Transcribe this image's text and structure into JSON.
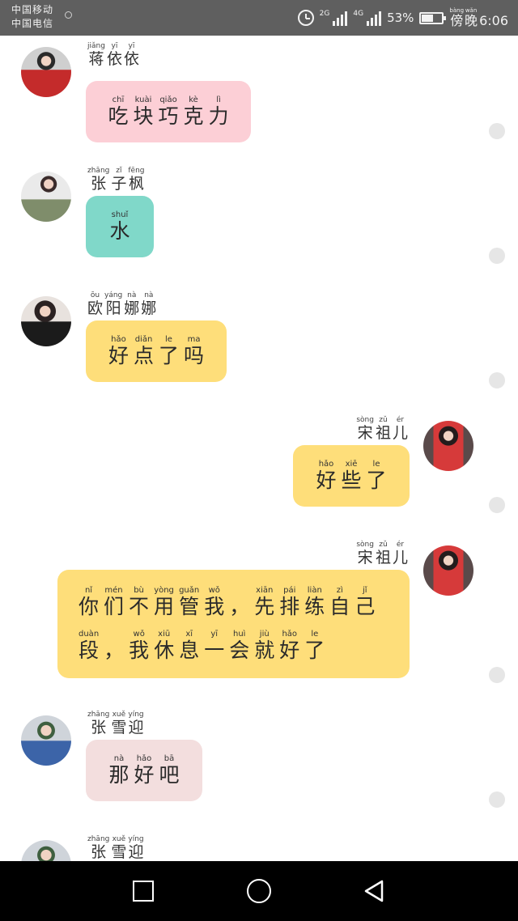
{
  "status_bar": {
    "carrier_1": "中国移动",
    "carrier_2": "中国电信",
    "net_1": "2G",
    "net_2": "4G",
    "battery_text": "53%",
    "battery_level": 0.53,
    "time_prefix": [
      {
        "py": "bàng",
        "hz": "傍"
      },
      {
        "py": "wǎn",
        "hz": "晚"
      }
    ],
    "time": "6:06",
    "alarm_icon": "alarm-clock-icon",
    "battery_icon": "battery-icon"
  },
  "messages": [
    {
      "side": "left",
      "sender": [
        {
          "py": "jiǎng",
          "hz": "蒋"
        },
        {
          "py": "yī",
          "hz": "依"
        },
        {
          "py": "yī",
          "hz": "依"
        }
      ],
      "bubble_color": "#fccfd6",
      "avatar": "avatar-girl-red-coat",
      "lines": [
        [
          {
            "py": "chī",
            "hz": "吃"
          },
          {
            "py": "kuài",
            "hz": "块"
          },
          {
            "py": "qiǎo",
            "hz": "巧"
          },
          {
            "py": "kè",
            "hz": "克"
          },
          {
            "py": "lì",
            "hz": "力"
          }
        ]
      ]
    },
    {
      "side": "left",
      "sender": [
        {
          "py": "zhāng",
          "hz": "张"
        },
        {
          "py": "zǐ",
          "hz": "子"
        },
        {
          "py": "fēng",
          "hz": "枫"
        }
      ],
      "bubble_color": "#80d8c9",
      "avatar": "avatar-girl-white-dress",
      "lines": [
        [
          {
            "py": "shuǐ",
            "hz": "水"
          }
        ]
      ]
    },
    {
      "side": "left",
      "sender": [
        {
          "py": "ōu",
          "hz": "欧"
        },
        {
          "py": "yáng",
          "hz": "阳"
        },
        {
          "py": "nà",
          "hz": "娜"
        },
        {
          "py": "nà",
          "hz": "娜"
        }
      ],
      "bubble_color": "#fede7a",
      "avatar": "avatar-girl-black-dress",
      "lines": [
        [
          {
            "py": "hǎo",
            "hz": "好"
          },
          {
            "py": "diǎn",
            "hz": "点"
          },
          {
            "py": "le",
            "hz": "了"
          },
          {
            "py": "ma",
            "hz": "吗"
          }
        ]
      ]
    },
    {
      "side": "right",
      "sender": [
        {
          "py": "sòng",
          "hz": "宋"
        },
        {
          "py": "zǔ",
          "hz": "祖"
        },
        {
          "py": "ér",
          "hz": "儿"
        }
      ],
      "bubble_color": "#fede7a",
      "avatar": "avatar-girl-red-dress",
      "lines": [
        [
          {
            "py": "hǎo",
            "hz": "好"
          },
          {
            "py": "xiē",
            "hz": "些"
          },
          {
            "py": "le",
            "hz": "了"
          }
        ]
      ]
    },
    {
      "side": "right",
      "sender": [
        {
          "py": "sòng",
          "hz": "宋"
        },
        {
          "py": "zǔ",
          "hz": "祖"
        },
        {
          "py": "ér",
          "hz": "儿"
        }
      ],
      "bubble_color": "#fede7a",
      "avatar": "avatar-girl-red-dress",
      "lines": [
        [
          {
            "py": "nǐ",
            "hz": "你"
          },
          {
            "py": "mén",
            "hz": "们"
          },
          {
            "py": "bù",
            "hz": "不"
          },
          {
            "py": "yòng",
            "hz": "用"
          },
          {
            "py": "guǎn",
            "hz": "管"
          },
          {
            "py": "wǒ",
            "hz": "我"
          },
          {
            "py": "",
            "hz": "，"
          },
          {
            "py": "xiān",
            "hz": "先"
          },
          {
            "py": "pái",
            "hz": "排"
          },
          {
            "py": "liàn",
            "hz": "练"
          },
          {
            "py": "zì",
            "hz": "自"
          },
          {
            "py": "jǐ",
            "hz": "己"
          }
        ],
        [
          {
            "py": "duàn",
            "hz": "段"
          },
          {
            "py": "",
            "hz": "，"
          },
          {
            "py": "wǒ",
            "hz": "我"
          },
          {
            "py": "xiū",
            "hz": "休"
          },
          {
            "py": "xī",
            "hz": "息"
          },
          {
            "py": "yī",
            "hz": "一"
          },
          {
            "py": "huì",
            "hz": "会"
          },
          {
            "py": "jiù",
            "hz": "就"
          },
          {
            "py": "hǎo",
            "hz": "好"
          },
          {
            "py": "le",
            "hz": "了"
          }
        ]
      ]
    },
    {
      "side": "left",
      "sender": [
        {
          "py": "zhāng",
          "hz": "张"
        },
        {
          "py": "xuě",
          "hz": "雪"
        },
        {
          "py": "yíng",
          "hz": "迎"
        }
      ],
      "bubble_color": "#f3dede",
      "avatar": "avatar-girl-denim",
      "lines": [
        [
          {
            "py": "nà",
            "hz": "那"
          },
          {
            "py": "hǎo",
            "hz": "好"
          },
          {
            "py": "bā",
            "hz": "吧"
          }
        ]
      ]
    },
    {
      "side": "left",
      "sender": [
        {
          "py": "zhāng",
          "hz": "张"
        },
        {
          "py": "xuě",
          "hz": "雪"
        },
        {
          "py": "yíng",
          "hz": "迎"
        }
      ],
      "bubble_color": "#f3dede",
      "avatar": "avatar-girl-denim",
      "lines": []
    }
  ],
  "nav_bar": {
    "recent_icon": "recent-apps-icon",
    "home_icon": "home-icon",
    "back_icon": "back-icon"
  }
}
